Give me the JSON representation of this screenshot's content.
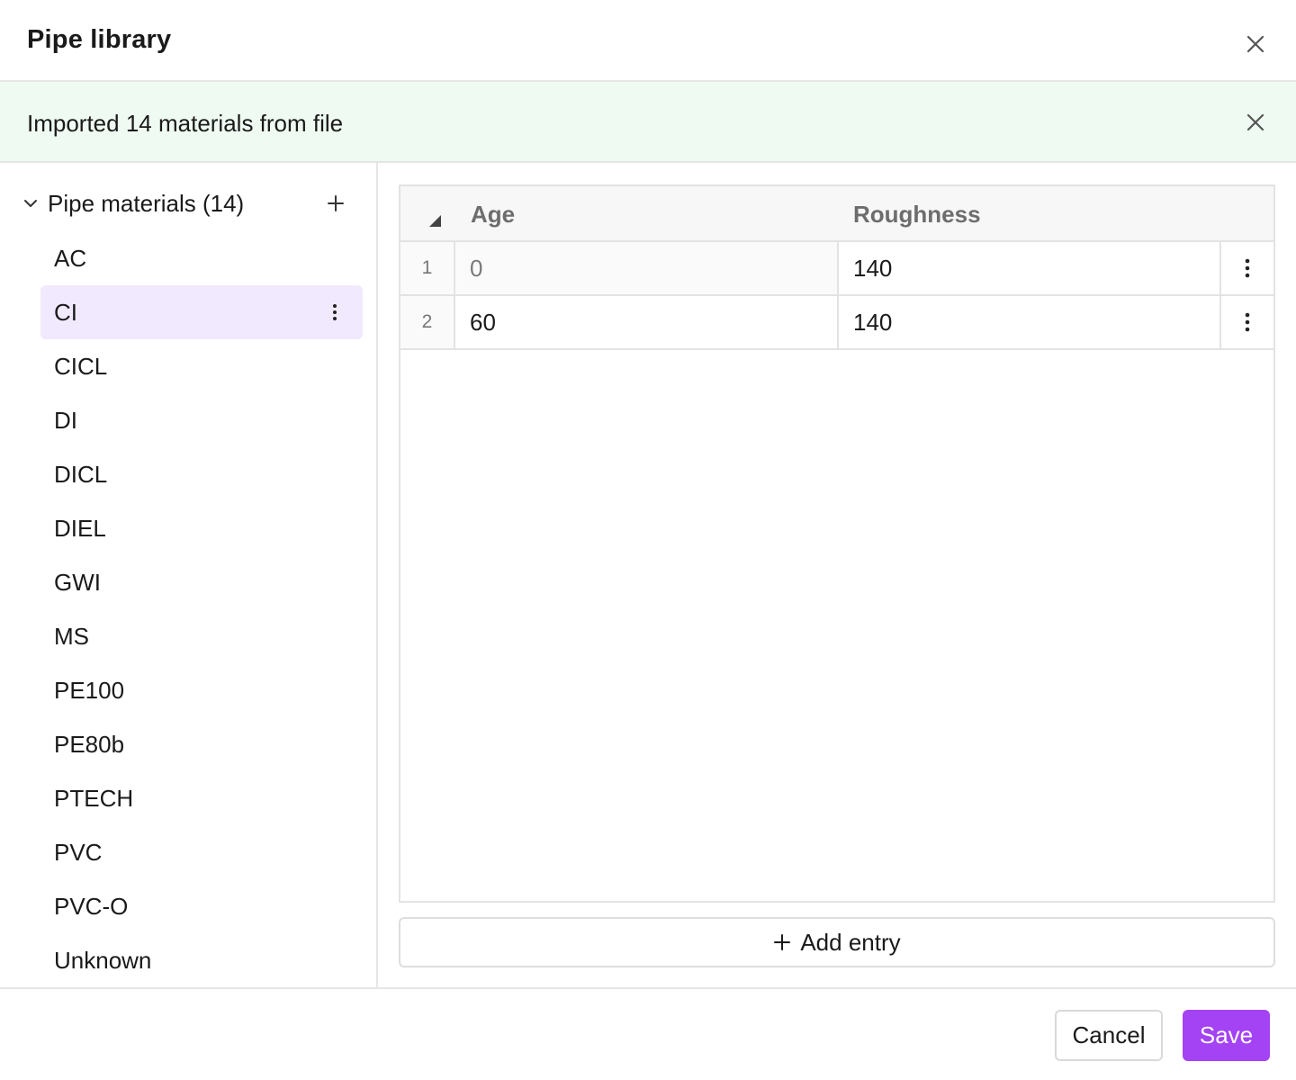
{
  "dialog": {
    "title": "Pipe library"
  },
  "banner": {
    "message": "Imported 14 materials from file",
    "color": "#effaf2"
  },
  "sidebar": {
    "group_title": "Pipe materials (14)",
    "expanded": true,
    "selected": "CI",
    "materials": [
      "AC",
      "CI",
      "CICL",
      "DI",
      "DICL",
      "DIEL",
      "GWI",
      "MS",
      "PE100",
      "PE80b",
      "PTECH",
      "PVC",
      "PVC-O",
      "Unknown"
    ]
  },
  "table": {
    "columns": [
      "Age",
      "Roughness"
    ],
    "rows": [
      {
        "num": "1",
        "age": "0",
        "roughness": "140"
      },
      {
        "num": "2",
        "age": "60",
        "roughness": "140"
      }
    ],
    "add_entry_label": "Add entry"
  },
  "footer": {
    "cancel_label": "Cancel",
    "save_label": "Save"
  },
  "colors": {
    "accent": "#a443f4",
    "selected_bg": "#f1e9fd",
    "banner_bg": "#effaf2"
  },
  "icons": {
    "close": "close-icon",
    "chevron": "chevron-down-icon",
    "add": "plus-icon",
    "menu": "kebab-menu-icon",
    "sort_corner": "corner-triangle-icon"
  }
}
